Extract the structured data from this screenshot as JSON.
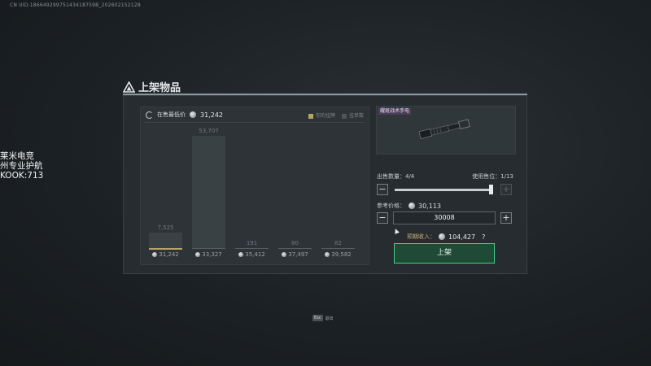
{
  "uid": "CN UID:18664929975143418759B_202602152128",
  "stream_overlay": [
    "莱米电竞",
    "州专业护航",
    "KOOK:713"
  ],
  "dialog": {
    "title": "上架物品",
    "chart": {
      "lowest_label": "在售最低价",
      "lowest_price": "31,242",
      "legend": [
        "你的挂牌",
        "挂单数"
      ]
    },
    "item": {
      "name": "耀斑战术手电"
    },
    "quantity": {
      "label": "出售数量：",
      "value": "4/4",
      "slots_label": "使用售位：",
      "slots_value": "1/13"
    },
    "reference": {
      "label": "参考价格：",
      "value": "30,113"
    },
    "price_input": "30008",
    "income": {
      "label": "预期收入：",
      "value": "104,427",
      "help": "?"
    },
    "list_button": "上架"
  },
  "esc_hint": {
    "key": "Esc",
    "label": "退出"
  },
  "colors": {
    "accent_gold": "#b7a46a",
    "confirm_green": "#3fd28a",
    "rarity_purple": "#4b3f57"
  },
  "chart_data": {
    "type": "bar",
    "title": "",
    "xlabel": "",
    "ylabel": "",
    "categories": [
      "31,242",
      "33,327",
      "35,412",
      "37,497",
      "39,582"
    ],
    "series": [
      {
        "name": "挂单数",
        "values": [
          7525,
          53707,
          191,
          80,
          82
        ]
      }
    ],
    "highlight_index": 0,
    "data_labels": [
      "7,525",
      "53,707",
      "191",
      "80",
      "82"
    ],
    "grid": false,
    "legend_position": "top-right"
  }
}
